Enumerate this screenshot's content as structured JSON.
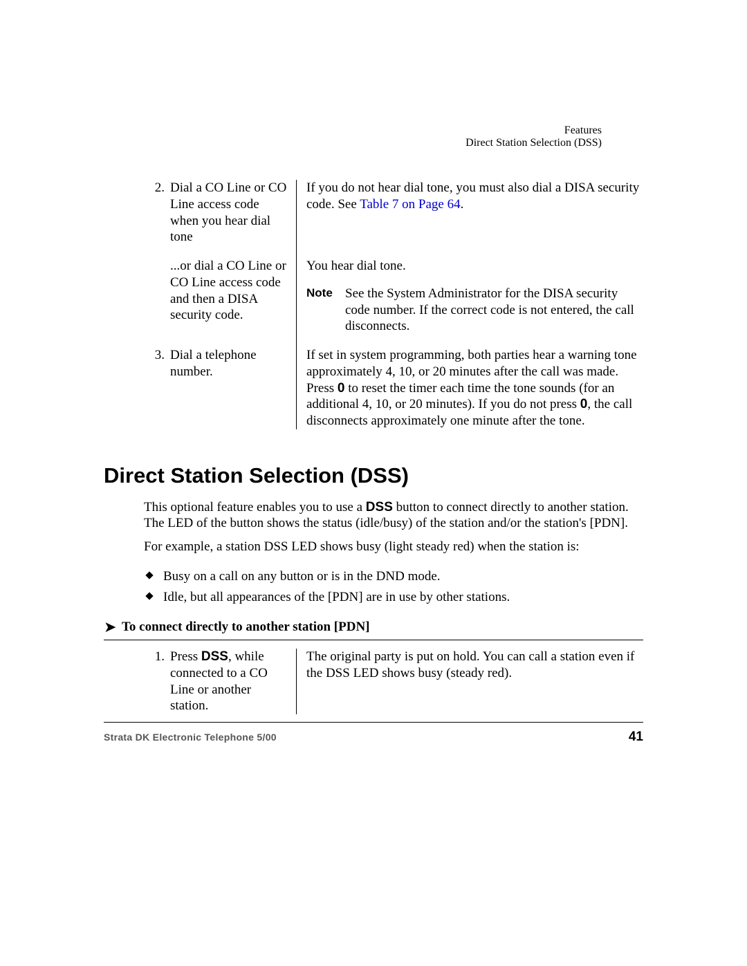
{
  "header": {
    "chapter": "Features",
    "section": "Direct Station Selection (DSS)"
  },
  "steps_top": {
    "step2": {
      "num": "2.",
      "left": "Dial a CO Line or CO Line access code when you hear dial tone",
      "right_a": "If you do not hear dial tone, you must also dial a DISA security code. See ",
      "right_link": "Table 7 on Page 64",
      "right_b": "."
    },
    "step2b": {
      "left": "...or dial a CO Line or CO Line access code and then a DISA security code.",
      "right1": "You hear dial tone.",
      "note_label": "Note",
      "note_text": "See the System Administrator for the DISA security code number. If the correct code is not entered, the call disconnects."
    },
    "step3": {
      "num": "3.",
      "left": "Dial a telephone number.",
      "r1": "If set in system programming, both parties hear a warning tone approximately 4, 10, or 20 minutes after the call was made. Press ",
      "r2": " to reset the timer each time the tone sounds (for an additional 4, 10, or 20 minutes). If you do not press ",
      "r3": ", the call disconnects approximately one minute after the tone.",
      "zero": "0"
    }
  },
  "section": {
    "title": "Direct Station Selection (DSS)",
    "p1a": "This optional feature enables you to use a ",
    "p1_dss": "DSS",
    "p1b": " button to connect directly to another station. The LED of the button shows the status (idle/busy) of the station and/or the station's [PDN].",
    "p2": "For example, a station DSS LED shows busy (light steady red) when the station is:",
    "b1": "Busy on a call on any button or is in the DND mode.",
    "b2": "Idle, but all appearances of the [PDN] are in use by other stations."
  },
  "proc": {
    "title": "To connect directly to another station [PDN]",
    "step1": {
      "num": "1.",
      "left_a": "Press ",
      "left_dss": "DSS",
      "left_b": ", while connected to a CO Line or another station.",
      "right": "The original party is put on hold. You can call a station even if the DSS LED shows busy (steady red)."
    }
  },
  "footer": {
    "left": "Strata DK Electronic Telephone  5/00",
    "page": "41"
  }
}
